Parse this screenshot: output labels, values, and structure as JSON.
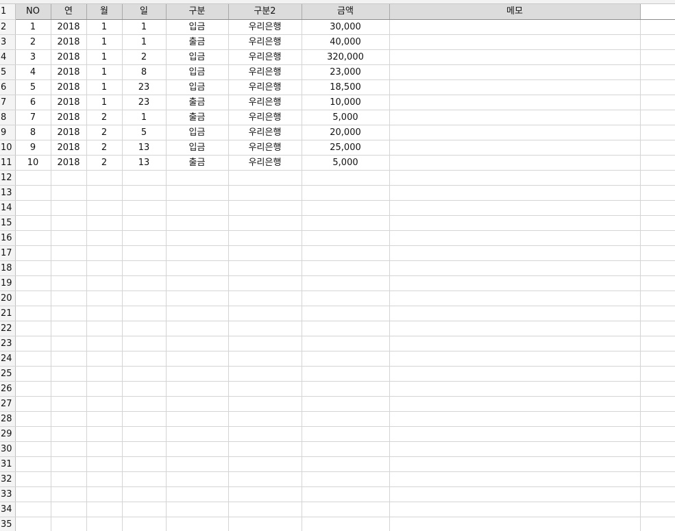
{
  "headers": [
    "NO",
    "연",
    "월",
    "일",
    "구분",
    "구분2",
    "금액",
    "메모"
  ],
  "row_numbers": [
    "1",
    "2",
    "3",
    "4",
    "5",
    "6",
    "7",
    "8",
    "9",
    "10",
    "11",
    "12",
    "13",
    "14",
    "15",
    "16",
    "17",
    "18",
    "19",
    "20",
    "21",
    "22",
    "23",
    "24",
    "25",
    "26",
    "27",
    "28",
    "29",
    "30",
    "31",
    "32",
    "33",
    "34",
    "35"
  ],
  "rows": [
    [
      "1",
      "2018",
      "1",
      "1",
      "입금",
      "우리은행",
      "30,000",
      ""
    ],
    [
      "2",
      "2018",
      "1",
      "1",
      "출금",
      "우리은행",
      "40,000",
      ""
    ],
    [
      "3",
      "2018",
      "1",
      "2",
      "입금",
      "우리은행",
      "320,000",
      ""
    ],
    [
      "4",
      "2018",
      "1",
      "8",
      "입금",
      "우리은행",
      "23,000",
      ""
    ],
    [
      "5",
      "2018",
      "1",
      "23",
      "입금",
      "우리은행",
      "18,500",
      ""
    ],
    [
      "6",
      "2018",
      "1",
      "23",
      "출금",
      "우리은행",
      "10,000",
      ""
    ],
    [
      "7",
      "2018",
      "2",
      "1",
      "출금",
      "우리은행",
      "5,000",
      ""
    ],
    [
      "8",
      "2018",
      "2",
      "5",
      "입금",
      "우리은행",
      "20,000",
      ""
    ],
    [
      "9",
      "2018",
      "2",
      "13",
      "입금",
      "우리은행",
      "25,000",
      ""
    ],
    [
      "10",
      "2018",
      "2",
      "13",
      "출금",
      "우리은행",
      "5,000",
      ""
    ]
  ]
}
